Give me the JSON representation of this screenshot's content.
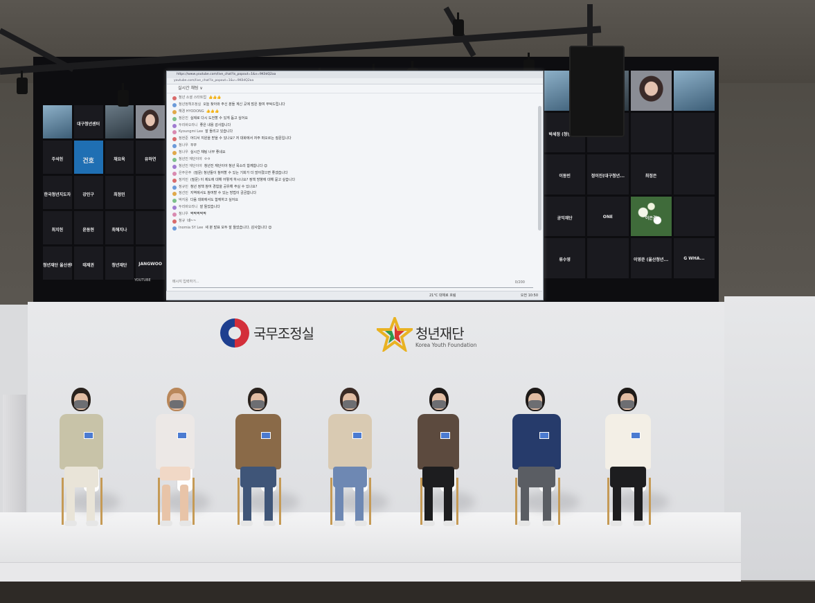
{
  "screen": {
    "url_line_1": "https://www.youtube.com/live_chat?is_popout=1&v=9K0dQ2aa",
    "url_line_2": "youtube.com/live_chat?is_popout=1&v=9K0dQ2aa",
    "chat_header": "실시간 채팅 ∨",
    "input_placeholder": "메시지 입력하기...",
    "char_counter": "0/200",
    "taskbar_time": "오전 10:50",
    "taskbar_weather": "21°C 대체로 흐림",
    "youtube_label": "YOUTUBE",
    "chat_messages": [
      {
        "user": "청년 소셜 스타트업",
        "text": "👍👍👍"
      },
      {
        "user": "청년정책조정실",
        "text": "오늘 찾아와 주신 분들 계신 곳에 많은 참여 부탁드립니다"
      },
      {
        "user": "해경 HYODONG",
        "text": "👍👍👍"
      },
      {
        "user": "정은진",
        "text": "실제로 다시 도전할 수 있게 돕고 싶어요"
      },
      {
        "user": "두리바오라니",
        "text": "좋은 내용 감사합니다"
      },
      {
        "user": "Kyoungmi Lee",
        "text": "잘 들리고 있습니다"
      },
      {
        "user": "정현준",
        "text": "어디서 지원을 받을 수 있나요? 저 대화에서 자주 떠오르는 질문입니다"
      },
      {
        "user": "청나우",
        "text": "꾸꾸"
      },
      {
        "user": "청나우",
        "text": "실시간 채팅 너무 좋네요"
      },
      {
        "user": "청년진 재단이야",
        "text": "ㅇㅇ"
      },
      {
        "user": "청년진 재단이야",
        "text": "청년진 재단이야 청년 목소리 함께합니다 😊"
      },
      {
        "user": "은주은주",
        "text": "(질문) 청년들이 참여할 수 있는 기회가 더 많아졌으면 좋겠습니다"
      },
      {
        "user": "정지민",
        "text": "(질문) 이 제도에 대해 어떻게 하시나요? 정책 방향에 대해 묻고 싶습니다"
      },
      {
        "user": "정규민",
        "text": "청년 정책 참여 경험을 공유해 주실 수 있나요?"
      },
      {
        "user": "정선민",
        "text": "지역에서도 참여할 수 있는 방법이 궁금합니다"
      },
      {
        "user": "박지웅",
        "text": "다음 대화에서도 함께하고 싶어요"
      },
      {
        "user": "두리바오라니",
        "text": "잘 들었습니다"
      },
      {
        "user": "청나우",
        "text": "짝짝짝짝짝"
      },
      {
        "user": "청규",
        "text": "네~~"
      },
      {
        "user": "Inomia SY Lee",
        "text": "새 분 발표 모두 잘 들었습니다. 감사합니다 😊"
      }
    ],
    "tiles_left": [
      "",
      "대구청년센터",
      "",
      "",
      "주석헌",
      "건호",
      "채요옥",
      "유하연",
      "한국청년지도자",
      "강민구",
      "최정민",
      "",
      "최지헌",
      "윤동현",
      "최해지나",
      "",
      "청년재단 울산센터",
      "태제권",
      "청년재단",
      "JANGWOO"
    ],
    "tiles_right": [
      "",
      "",
      "",
      "",
      "박세정 (청년재단)",
      "김보혜",
      "",
      "",
      "이동빈",
      "정이진(대구청년...",
      "최정은",
      "",
      "공익재단",
      "ONE",
      "이은결",
      "",
      "류수영",
      "",
      "이영준 (울산청년...",
      "G WHA..."
    ]
  },
  "logos": {
    "gov_text": "국무조정실",
    "foundation_text": "청년재단",
    "foundation_sub": "Korea Youth Foundation"
  }
}
